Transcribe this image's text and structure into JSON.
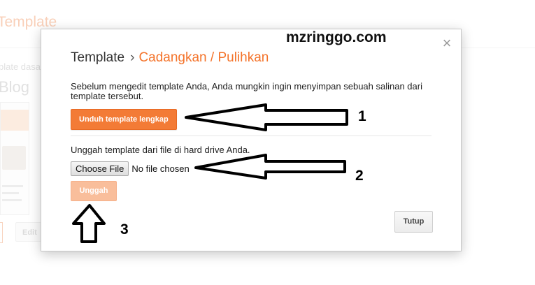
{
  "background_page": {
    "header_title": "Template",
    "subtitle": "plate dasar",
    "blog_label": "Blog",
    "edit_button": "Edit"
  },
  "watermark": "mzringgo.com",
  "dialog": {
    "breadcrumb_root": "Template",
    "breadcrumb_separator": "›",
    "breadcrumb_current": "Cadangkan / Pulihkan",
    "intro_text": "Sebelum mengedit template Anda, Anda mungkin ingin menyimpan sebuah salinan dari template tersebut.",
    "download_button": "Unduh template lengkap",
    "upload_label": "Unggah template dari file di hard drive Anda.",
    "choose_file_button": "Choose File",
    "file_status": "No file chosen",
    "upload_button": "Unggah",
    "close_button": "Tutup",
    "close_icon": "×"
  },
  "annotations": [
    "1",
    "2",
    "3"
  ],
  "colors": {
    "accent": "#f37b36",
    "accent_disabled": "#f9be9b",
    "title_accent": "#f4732a"
  }
}
